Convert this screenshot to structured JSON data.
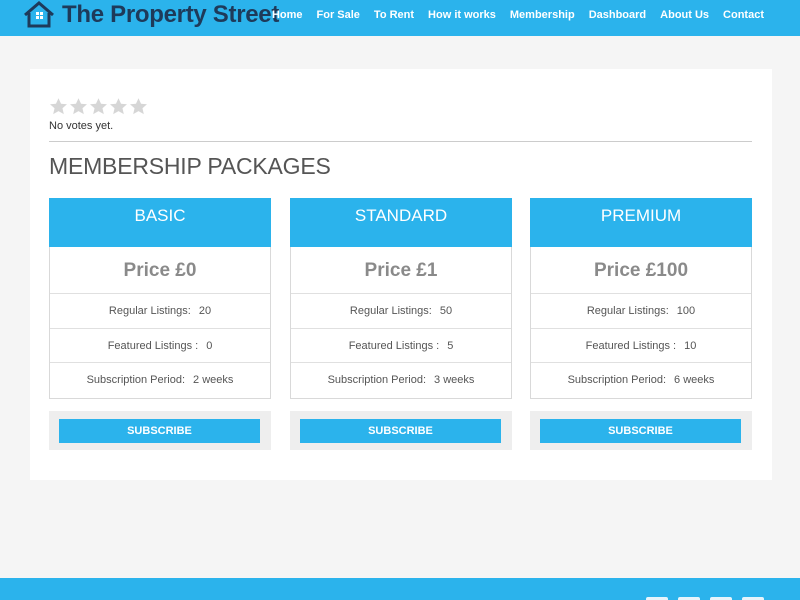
{
  "brand": {
    "name": "The Property Street"
  },
  "nav": {
    "items": [
      "Home",
      "For Sale",
      "To Rent",
      "How it works",
      "Membership",
      "Dashboard",
      "About Us",
      "Contact"
    ]
  },
  "rating": {
    "votes_text": "No votes yet.",
    "stars_filled": 0,
    "stars_total": 5
  },
  "heading": "MEMBERSHIP PACKAGES",
  "packages": [
    {
      "name": "BASIC",
      "price": "Price £0",
      "rows": [
        {
          "label": "Regular Listings:",
          "value": "20"
        },
        {
          "label": "Featured Listings :",
          "value": "0"
        },
        {
          "label": "Subscription Period:",
          "value": "2 weeks"
        }
      ],
      "button": "SUBSCRIBE"
    },
    {
      "name": "STANDARD",
      "price": "Price £1",
      "rows": [
        {
          "label": "Regular Listings:",
          "value": "50"
        },
        {
          "label": "Featured Listings :",
          "value": "5"
        },
        {
          "label": "Subscription Period:",
          "value": "3 weeks"
        }
      ],
      "button": "SUBSCRIBE"
    },
    {
      "name": "PREMIUM",
      "price": "Price £100",
      "rows": [
        {
          "label": "Regular Listings:",
          "value": "100"
        },
        {
          "label": "Featured Listings :",
          "value": "10"
        },
        {
          "label": "Subscription Period:",
          "value": "6 weeks"
        }
      ],
      "button": "SUBSCRIBE"
    }
  ],
  "colors": {
    "accent": "#2bb3ec",
    "brand_text": "#1e3a5a",
    "star_empty": "#d6d6d6"
  },
  "footer": {
    "social_icons": [
      "social-icon",
      "social-icon",
      "social-icon",
      "social-icon"
    ]
  }
}
